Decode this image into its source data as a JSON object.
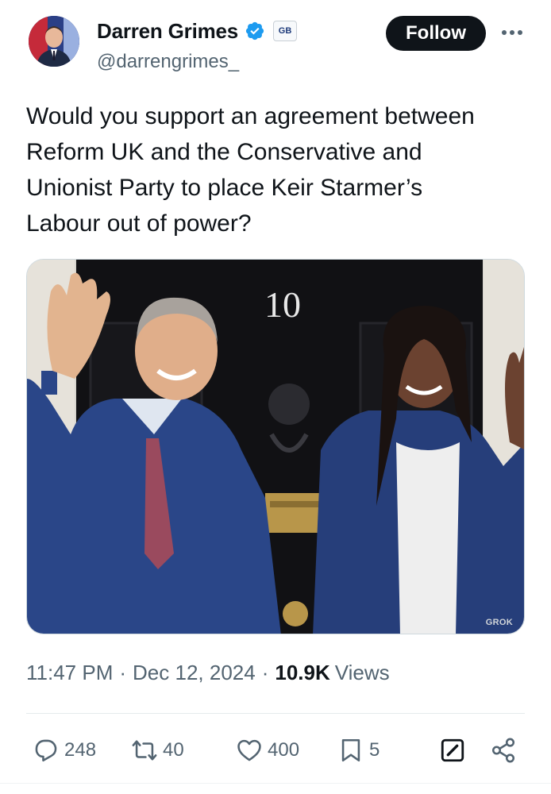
{
  "author": {
    "display_name": "Darren Grimes",
    "handle": "@darrengrimes_",
    "affiliation_badge": "GB",
    "verified_color": "#1d9bf0"
  },
  "header": {
    "follow_label": "Follow",
    "more_icon": "more-horizontal-icon"
  },
  "tweet": {
    "text": "Would you support an agreement between\nReform UK and the Conservative and\nUnionist Party to place Keir Starmer’s\nLabour out of power?"
  },
  "media": {
    "door_number": "10",
    "watermark": "GROK"
  },
  "meta": {
    "time": "11:47 PM",
    "separator": "·",
    "date": "Dec 12, 2024",
    "views_count": "10.9K",
    "views_label": "Views"
  },
  "actions": {
    "replies": "248",
    "reposts": "40",
    "likes": "400",
    "bookmarks": "5"
  }
}
